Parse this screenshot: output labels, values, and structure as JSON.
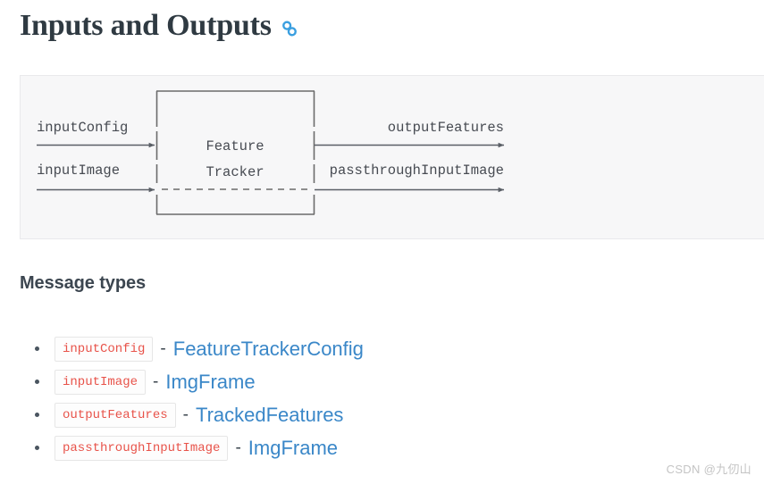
{
  "heading": {
    "title": "Inputs and Outputs",
    "anchor_icon": "link-chain-icon",
    "anchor_color": "#3a9fe0"
  },
  "diagram": {
    "block_lines": [
      "Feature",
      "Tracker"
    ],
    "inputs": [
      {
        "label": "inputConfig"
      },
      {
        "label": "inputImage"
      }
    ],
    "outputs": [
      {
        "label": "outputFeatures"
      },
      {
        "label": "passthroughInputImage"
      }
    ],
    "background": "#f7f7f8",
    "line_color": "#6b6b6b"
  },
  "section": {
    "title": "Message types"
  },
  "message_types": [
    {
      "port": "inputConfig",
      "separator": "-",
      "type": "FeatureTrackerConfig"
    },
    {
      "port": "inputImage",
      "separator": "-",
      "type": "ImgFrame"
    },
    {
      "port": "outputFeatures",
      "separator": "-",
      "type": "TrackedFeatures"
    },
    {
      "port": "passthroughInputImage",
      "separator": "-",
      "type": "ImgFrame"
    }
  ],
  "watermark": {
    "text": "CSDN @九仞山"
  }
}
